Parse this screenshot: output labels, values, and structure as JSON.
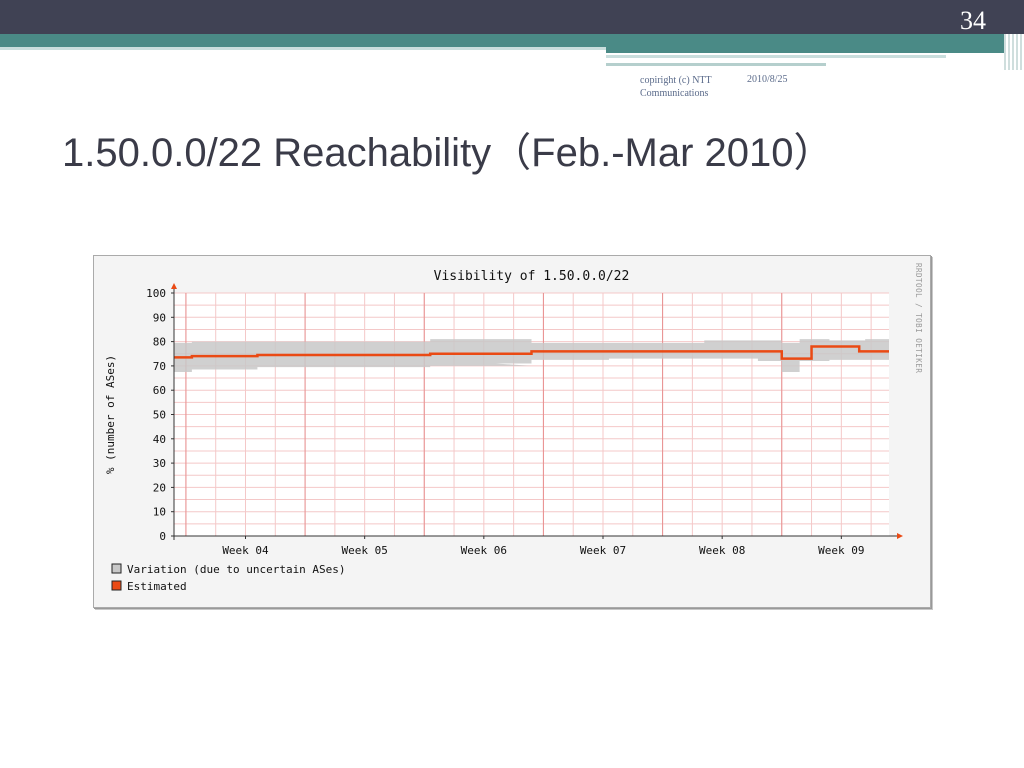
{
  "slide": {
    "page_number": "34",
    "footer_copyright": "copiright (c) NTT Communications",
    "footer_date": "2010/8/25",
    "title": "1.50.0.0/22 Reachability（Feb.-Mar 2010）"
  },
  "colors": {
    "header_dark": "#404254",
    "header_teal": "#4a8a86",
    "estimated_line": "#ea4a14",
    "variation_band": "#c8c8c8",
    "grid_minor": "#f4c8c8",
    "grid_major": "#e89090"
  },
  "chart_data": {
    "type": "line",
    "title": "Visibility of 1.50.0.0/22",
    "xlabel": "",
    "ylabel": "% (number of ASes)",
    "ylim": [
      0,
      100
    ],
    "yticks": [
      0,
      10,
      20,
      30,
      40,
      50,
      60,
      70,
      80,
      90,
      100
    ],
    "x_tick_labels": [
      "Week 04",
      "Week 05",
      "Week 06",
      "Week 07",
      "Week 08",
      "Week 09"
    ],
    "xlim": [
      3.4,
      9.4
    ],
    "watermark": "RRDTOOL / TOBI OETIKER",
    "legend": [
      "Variation (due to uncertain ASes)",
      "Estimated"
    ],
    "legend_position": "bottom-left",
    "grid": true,
    "series": [
      {
        "name": "Estimated",
        "x": [
          3.4,
          3.55,
          3.55,
          4.1,
          4.1,
          5.55,
          5.55,
          6.4,
          6.4,
          7.05,
          7.05,
          7.85,
          7.85,
          8.5,
          8.5,
          8.75,
          8.75,
          9.15,
          9.15,
          9.4
        ],
        "y": [
          73.5,
          73.5,
          74,
          74,
          74.5,
          74.5,
          75,
          75,
          76,
          76,
          76,
          76,
          76,
          76,
          73,
          73,
          78,
          78,
          76,
          76
        ]
      },
      {
        "name": "Variation (due to uncertain ASes)",
        "x": [
          3.4,
          3.55,
          3.55,
          4.1,
          4.1,
          5.55,
          5.55,
          6.4,
          6.1,
          6.4,
          6.4,
          7.05,
          7.05,
          7.85,
          7.85,
          8.3,
          8.3,
          8.5,
          8.5,
          8.65,
          8.65,
          8.9,
          8.9,
          9.2,
          9.2,
          9.4
        ],
        "lower": [
          67.5,
          67.5,
          68.5,
          68.5,
          69.5,
          69.5,
          70,
          70,
          71,
          71,
          72.5,
          72.5,
          73,
          73,
          73,
          73,
          72,
          72,
          67.5,
          67.5,
          72,
          72,
          72.5,
          72.5,
          72.5,
          72.5
        ],
        "upper": [
          79.5,
          79.5,
          80,
          80,
          80,
          80,
          81,
          81,
          81,
          81,
          79.5,
          79.5,
          79.5,
          79.5,
          80.5,
          80.5,
          80.5,
          80.5,
          79.5,
          79.5,
          81,
          81,
          80.5,
          80.5,
          81,
          81
        ]
      }
    ]
  }
}
